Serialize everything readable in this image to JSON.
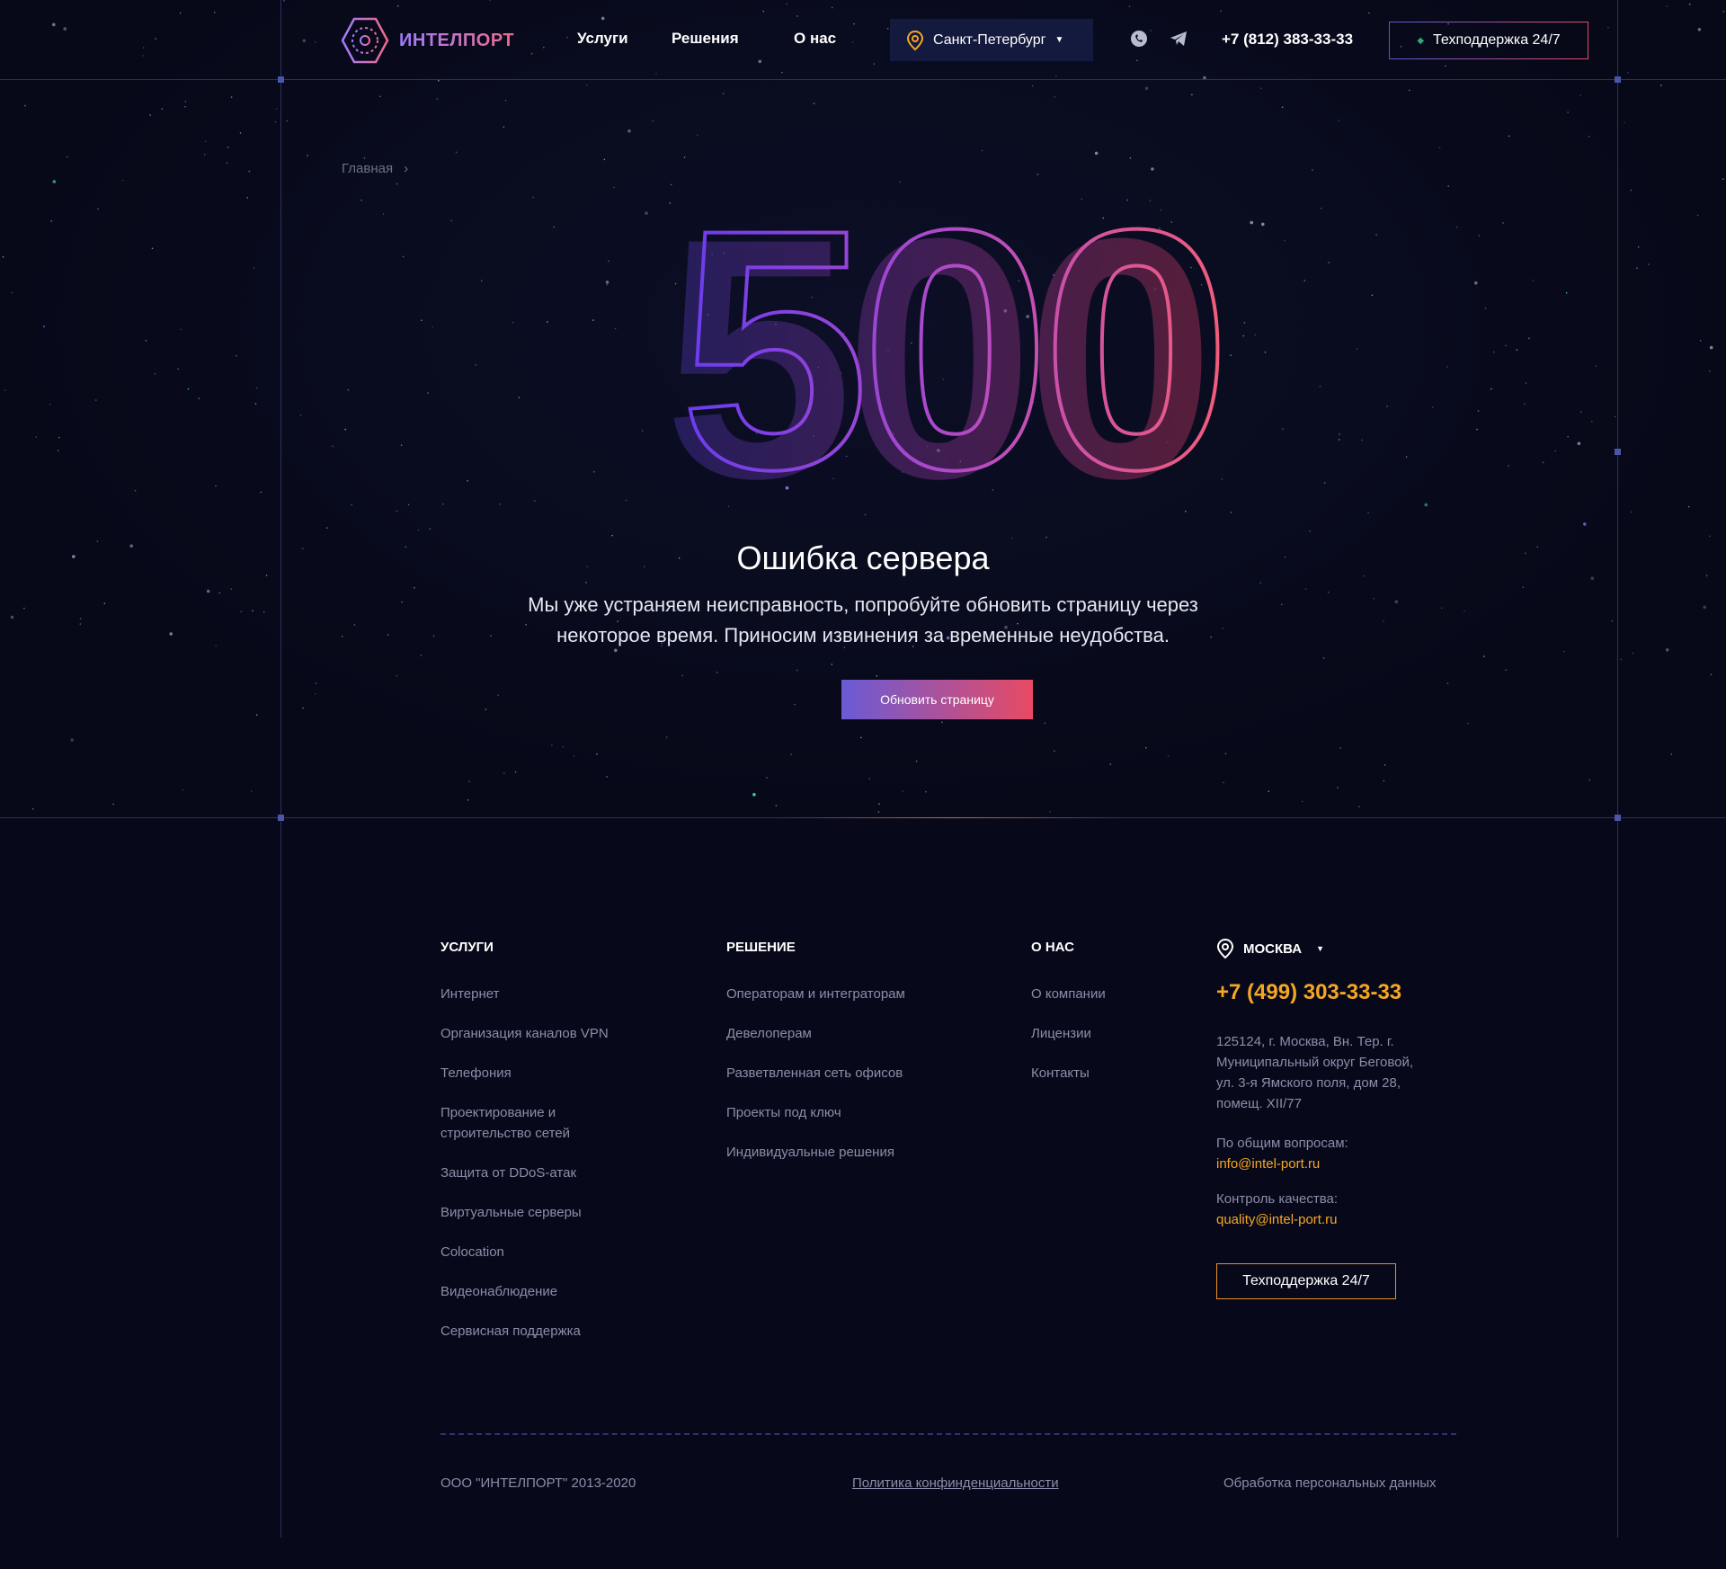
{
  "header": {
    "logo_text": "ИНТЕЛПОРТ",
    "nav": [
      "Услуги",
      "Решения",
      "О нас"
    ],
    "city": "Санкт-Петербург",
    "phone": "+7 (812) 383-33-33",
    "support": "Техподдержка 24/7"
  },
  "breadcrumb": {
    "home": "Главная"
  },
  "error": {
    "code": "500",
    "title": "Ошибка сервера",
    "line1": "Мы уже устраняем неисправность, попробуйте обновить страницу через",
    "line2": "некоторое время. Приносим извинения за временные неудобства.",
    "button": "Обновить страницу"
  },
  "footer": {
    "services": {
      "title": "УСЛУГИ",
      "items": [
        "Интернет",
        "Организация каналов VPN",
        "Телефония",
        "Проектирование и",
        "строительство сетей",
        "Защита от DDoS-атак",
        "Виртуальные серверы",
        "Colocation",
        "Видеонаблюдение",
        "Сервисная поддержка"
      ]
    },
    "solutions": {
      "title": "РЕШЕНИЕ",
      "items": [
        "Операторам и интеграторам",
        "Девелоперам",
        "Разветвленная сеть офисов",
        "Проекты под ключ",
        "Индивидуальные решения"
      ]
    },
    "about": {
      "title": "О НАС",
      "items": [
        "О компании",
        "Лицензии",
        "Контакты"
      ]
    },
    "contacts": {
      "city": "МОСКВА",
      "phone": "+7 (499) 303-33-33",
      "address": [
        "125124, г. Москва, Вн. Тер. г.",
        "Муниципальный округ Беговой,",
        "ул. 3-я Ямского поля, дом 28,",
        "помещ. XII/77"
      ],
      "general_label": "По общим вопросам:",
      "general_email": "info@intel-port.ru",
      "quality_label": "Контроль качества:",
      "quality_email": "quality@intel-port.ru",
      "support": "Техподдержка 24/7"
    },
    "copyright": "ООО \"ИНТЕЛПОРТ\" 2013-2020",
    "privacy": "Политика конфинденциальности",
    "personal": "Обработка персональных данных"
  },
  "colors": {
    "accent": "#f5a623",
    "gradient_start": "#6a3cf0",
    "gradient_end": "#f25c7a",
    "background": "#07091a"
  }
}
